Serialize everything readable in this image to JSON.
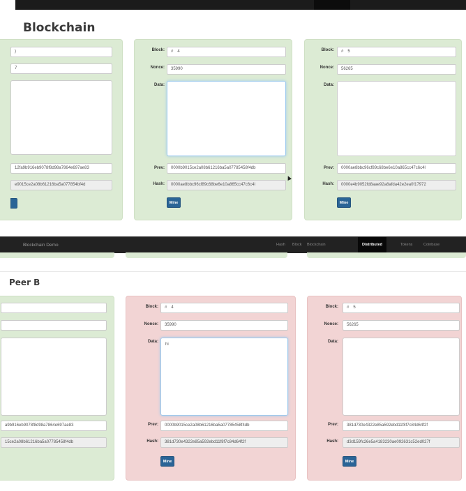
{
  "top": {
    "title": "Blockchain",
    "labels": {
      "block": "Block:",
      "nonce": "Nonce:",
      "data": "Data:",
      "prev": "Prev:",
      "hash": "Hash:"
    },
    "mine_label": "Mine",
    "hash_sign": "#",
    "partial_card": {
      "prev": "12fa9b916eb9078f8d98a7864e697ae83",
      "hash": "e9015ce2a08b61216ba5a077854bf4d",
      "nonce_tail": "7",
      "block_tail": ")"
    },
    "card4": {
      "block": "4",
      "nonce": "35990",
      "data": "",
      "prev": "0000b9015ce2a08b61216ba5a07785458f4db",
      "hash": "0000ae8bbc96cf89c68be6e10a865cc47c6c4l"
    },
    "card5": {
      "block": "5",
      "nonce": "56265",
      "data": "",
      "prev": "0000ae8bbc96cf89c68be6e10a865cc47c6c4l",
      "hash": "0000e4b9052fd8aae92a8afda42e2ea0f17972"
    }
  },
  "navbar": {
    "brand": "Blockchain Demo",
    "items": [
      "Hash",
      "Block",
      "Blockchain",
      "Distributed",
      "Tokens",
      "Coinbase"
    ],
    "active": "Distributed"
  },
  "peer_b": {
    "title": "Peer B",
    "partial_card": {
      "prev": "a9b916eb9078f8d98a7864e697ae83",
      "hash": "15ce2a08b61216ba5a07785458f4db"
    },
    "card4": {
      "block": "4",
      "nonce": "35990",
      "data": "hi",
      "prev": "0000b9015ce2a08b61216ba5a07785458f4db",
      "hash": "381d730e4322e85a592ebd11f8f7c84d64f2f"
    },
    "card5": {
      "block": "5",
      "nonce": "56265",
      "data": "",
      "prev": "381d730e4322e85a592ebd11f8f7c84d64f2f",
      "hash": "d3d159fc26e5a4183230ae092631c52ed027f"
    }
  },
  "colors": {
    "valid": "#dcebd4",
    "invalid": "#f2d4d4",
    "mine_button": "#2a6496",
    "navbar": "#222222"
  }
}
